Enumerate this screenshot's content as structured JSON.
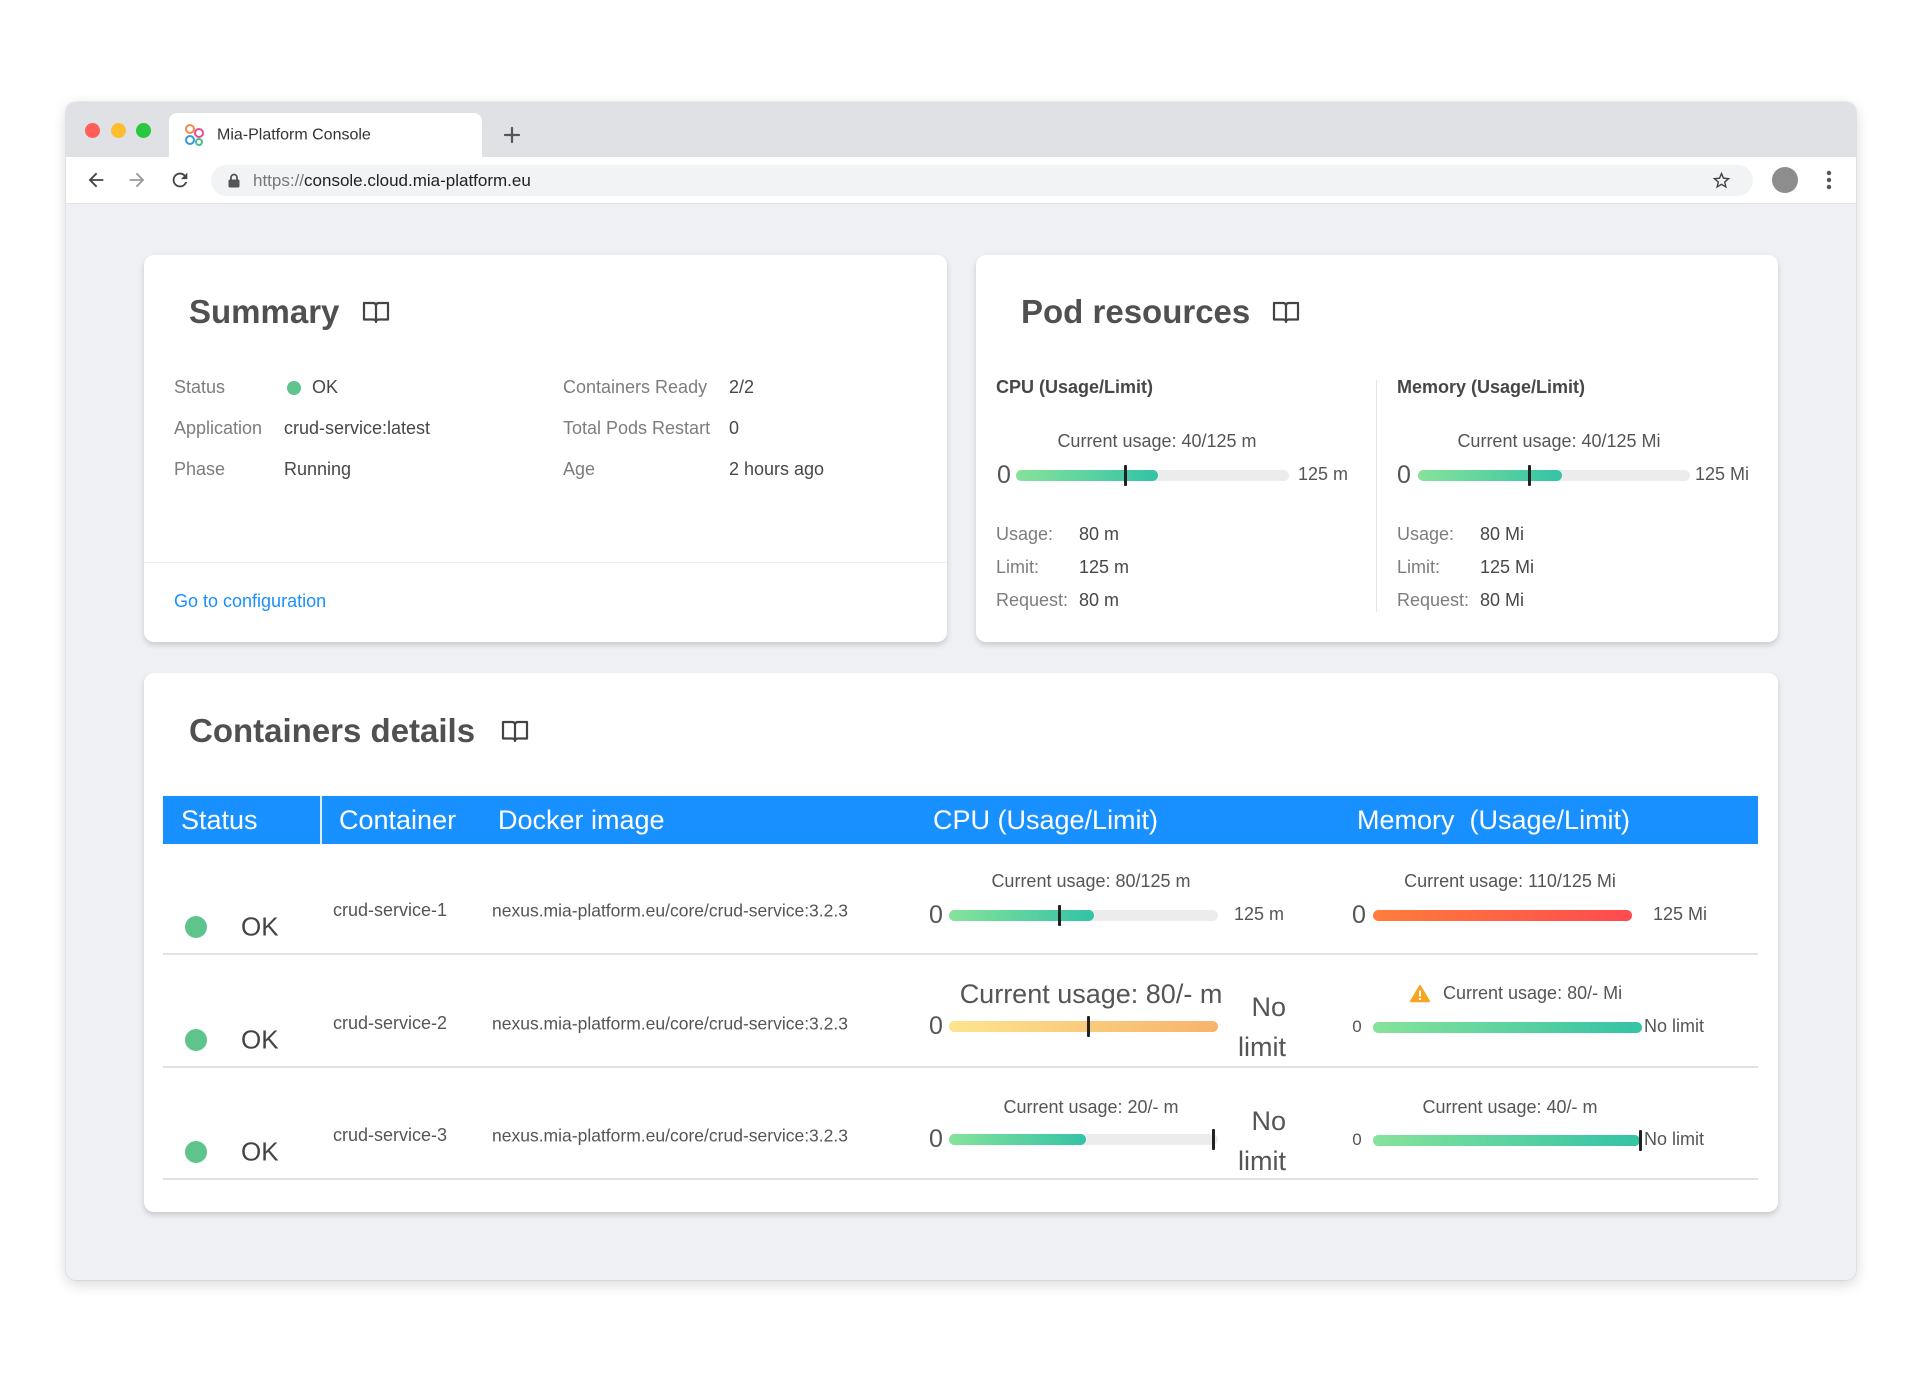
{
  "browser": {
    "tab_title": "Mia-Platform Console",
    "url_scheme": "https://",
    "url_host": "console.cloud.mia-platform.eu",
    "icons": {
      "favicon": "mia-platform-logo-icon",
      "new_tab": "plus-icon",
      "back": "arrow-left-icon",
      "forward": "arrow-right-icon",
      "reload": "reload-icon",
      "secure": "lock-icon",
      "bookmark": "star-icon",
      "profile": "avatar-icon",
      "menu": "kebab-menu-icon"
    }
  },
  "summary": {
    "title": "Summary",
    "title_icon": "book-icon",
    "fields": [
      {
        "label": "Status",
        "value": "OK"
      },
      {
        "label": "Application",
        "value": "crud-service:latest"
      },
      {
        "label": "Phase",
        "value": "Running"
      },
      {
        "label": "Containers Ready",
        "value": "2/2"
      },
      {
        "label": "Total Pods Restart",
        "value": "0"
      },
      {
        "label": "Age",
        "value": "2 hours ago"
      }
    ],
    "link": "Go to configuration"
  },
  "pod_resources": {
    "title": "Pod resources",
    "title_icon": "book-icon",
    "cpu": {
      "heading": "CPU (Usage/Limit)",
      "current_usage": "Current usage: 40/125 m",
      "min_label": "0",
      "max_label": "125 m",
      "fill": 0.52,
      "marker": 0.4,
      "gradient": "gradient_green",
      "details": [
        {
          "label": "Usage:",
          "value": "80 m"
        },
        {
          "label": "Limit:",
          "value": "125 m"
        },
        {
          "label": "Request:",
          "value": "80 m"
        }
      ]
    },
    "memory": {
      "heading": "Memory (Usage/Limit)",
      "current_usage": "Current usage: 40/125 Mi",
      "min_label": "0",
      "max_label": "125 Mi",
      "fill": 0.53,
      "marker": 0.41,
      "gradient": "gradient_green",
      "details": [
        {
          "label": "Usage:",
          "value": "80 Mi"
        },
        {
          "label": "Limit:",
          "value": "125 Mi"
        },
        {
          "label": "Request:",
          "value": "80 Mi"
        }
      ]
    }
  },
  "containers": {
    "title": "Containers details",
    "title_icon": "book-icon",
    "columns": [
      "Status",
      "Container",
      "Docker image",
      "CPU (Usage/Limit)",
      "Memory  (Usage/Limit)"
    ],
    "rows": [
      {
        "status": "OK",
        "name": "crud-service-1",
        "image": "nexus.mia-platform.eu/core/crud-service:3.2.3",
        "cpu": {
          "current_usage": "Current usage: 80/125 m",
          "min_label": "0",
          "max_label": "125 m",
          "fill": 0.54,
          "marker": 0.41,
          "gradient": "gradient_green"
        },
        "memory": {
          "current_usage": "Current usage: 110/125 Mi",
          "min_label": "0",
          "max_label": "125 Mi",
          "fill": 1.0,
          "marker": null,
          "gradient": "gradient_red"
        }
      },
      {
        "status": "OK",
        "name": "crud-service-2",
        "image": "nexus.mia-platform.eu/core/crud-service:3.2.3",
        "cpu": {
          "current_usage": "Current usage: 80/- m",
          "min_label": "0",
          "max_label": "No limit",
          "fill": 1.0,
          "marker": 0.52,
          "gradient": "gradient_yellow"
        },
        "memory": {
          "current_usage": "Current usage: 80/- Mi",
          "min_label": "0",
          "max_label": "No limit",
          "fill": 1.0,
          "marker": null,
          "gradient": "gradient_green",
          "icon": "warning-icon"
        }
      },
      {
        "status": "OK",
        "name": "crud-service-3",
        "image": "nexus.mia-platform.eu/core/crud-service:3.2.3",
        "cpu": {
          "current_usage": "Current usage: 20/- m",
          "min_label": "0",
          "max_label": "No limit",
          "fill": 0.51,
          "marker": 0.985,
          "gradient": "gradient_green"
        },
        "memory": {
          "current_usage": "Current usage: 40/- m",
          "min_label": "0",
          "max_label": "No limit",
          "fill": 1.0,
          "marker": 1.0,
          "gradient": "gradient_green"
        }
      }
    ]
  },
  "colors": {
    "primary": "#1890ff",
    "status_ok": "#5ec48c",
    "bar_track": "#ececec",
    "marker": "#222222",
    "warning": "#f5a623",
    "gradient_green": [
      "#86e39a",
      "#33c3a6"
    ],
    "gradient_yellow": [
      "#fde48f",
      "#f7b36c"
    ],
    "gradient_red": [
      "#ff7d3b",
      "#ff4a4f"
    ]
  }
}
